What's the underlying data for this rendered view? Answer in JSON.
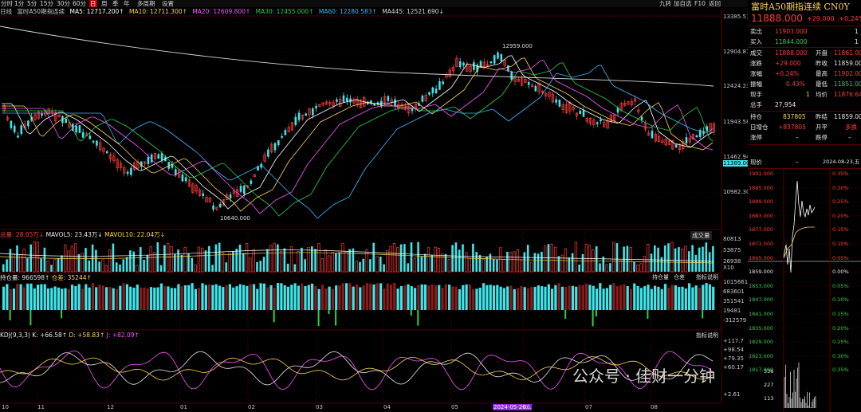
{
  "toolbar": {
    "timeframes": [
      "分时",
      "1分",
      "5分",
      "15分",
      "30分",
      "60分",
      "日",
      "周",
      "季",
      "年",
      "多周期",
      "设置"
    ],
    "selected": "日",
    "right_items": [
      "九转",
      "加自选",
      "F10",
      "返回"
    ]
  },
  "main_legend": {
    "period": "日线",
    "name": "富时A50期指连续",
    "ma": [
      {
        "label": "MA5: 12717.200↑",
        "color": "#ffffff"
      },
      {
        "label": "MA10: 12711.300↑",
        "color": "#ffd34d"
      },
      {
        "label": "MA20: 12609.800↑",
        "color": "#ff55ff"
      },
      {
        "label": "MA30: 12455.000↑",
        "color": "#2ad04d"
      },
      {
        "label": "MA60: 12280.583↑",
        "color": "#3eb8ff"
      },
      {
        "label": "MA445: 12521.690↓",
        "color": "#d8d8d8"
      }
    ]
  },
  "price_axis": [
    "13385.51",
    "12904.87",
    "12424.23",
    "11943.58",
    "11462.94",
    "11389.00",
    "10982.30"
  ],
  "annotations": {
    "high": "12959.000",
    "low": "10640.000"
  },
  "volume_panel": {
    "legend_volume": "总量: 28.05万↓",
    "legend_mavol5": "MAVOL5: 23.43万↓",
    "legend_mavol10": "MAVOL10: 22.04万↓",
    "button": "成交量",
    "axis": [
      "80813",
      "53875",
      "26938",
      "X10"
    ]
  },
  "oi_panel": {
    "legend_oi": "持仓量: 966598↑",
    "legend_add": "仓差: 35244↑",
    "buttons": [
      "持仓量",
      "仓差",
      "指标说明"
    ],
    "axis": [
      "1015661",
      "683601",
      "351541",
      "19481",
      "-312579"
    ]
  },
  "kdj_panel": {
    "legend_name": "KDJ(9,3,3)",
    "legend_k": "K: +66.58↑",
    "legend_d": "D: +58.83↑",
    "legend_j": "J: +82.09↑",
    "button": "指标说明",
    "axis": [
      "+117.7",
      "+98.54",
      "+79.35",
      "+60.17",
      "+2.61"
    ]
  },
  "date_axis": [
    "10",
    "11",
    "12",
    "01",
    "02",
    "03",
    "04",
    "05",
    "2024-05-20...",
    "06",
    "07",
    "08"
  ],
  "watermark": "公众号 · 佳财一分钟",
  "right_panel": {
    "title": "富时A50期指连续 CN0Y",
    "price": "11888.000",
    "change": "+29.000",
    "pct": "+0.24%",
    "rows": [
      {
        "l": "卖出",
        "v": "11903.000",
        "v2": "1"
      },
      {
        "l": "买入",
        "v": "11844.000",
        "v2": "1"
      },
      {
        "l": "成交",
        "v": "11888.000",
        "l2": "开盘",
        "v3": "11861.000"
      },
      {
        "l": "涨跌",
        "v": "+29.000",
        "l2": "昨收",
        "v3": "11859.000"
      },
      {
        "l": "涨幅",
        "v": "+0.24%",
        "l2": "最高",
        "v3": "11902.000"
      },
      {
        "l": "振幅",
        "v": "0.43%",
        "l2": "最低",
        "v3": "11851.000"
      },
      {
        "l": "现手",
        "v": "1",
        "l2": "均价",
        "v3": "11876.640"
      },
      {
        "l": "总手",
        "v": "27,954"
      },
      {
        "l": "持仓",
        "v": "837805",
        "l2": "昨结",
        "v3": "11859.000"
      },
      {
        "l": "日增仓",
        "v": "+837805",
        "l2": "开平",
        "v3": "多换"
      },
      {
        "l": "涨停",
        "v": "–",
        "l2": "跌停",
        "v3": "–"
      }
    ],
    "now_label": "现价",
    "now_dash": "–",
    "now_date": "2024-08-23,五",
    "mini_prices": [
      "1901.000",
      "1895.000",
      "1889.000",
      "1883.000",
      "1877.000",
      "1871.000",
      "1865.000",
      "1859.000",
      "1853.000",
      "1847.000",
      "1841.000",
      "1835.000",
      "1829.000",
      "1823.000",
      "1817.000"
    ],
    "mini_pcts": [
      "0.35%",
      "0.30%",
      "0.25%",
      "0.20%",
      "0.15%",
      "0.10%",
      "0.05%",
      "0.00%",
      "0.05%",
      "0.10%",
      "0.15%",
      "0.20%",
      "0.25%",
      "0.30%",
      "0.35%"
    ],
    "mini_vol": [
      "336",
      "227",
      "113"
    ]
  }
}
